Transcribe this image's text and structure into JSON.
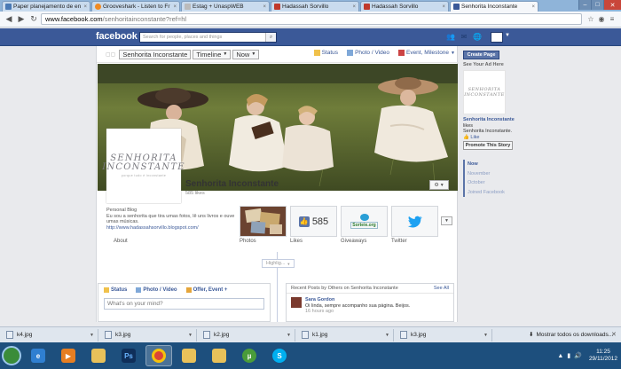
{
  "browser": {
    "tabs": [
      {
        "label": "Paper planejamento de en",
        "icon_color": "#4a7ab5",
        "active": false
      },
      {
        "label": "Grooveshark - Listen to Fr",
        "icon_color": "#f08a24",
        "active": false
      },
      {
        "label": "Estag + UnaspWEB",
        "icon_color": "#8a8a8a",
        "active": false
      },
      {
        "label": "Hadassah Sorvillo",
        "icon_color": "#c0392b",
        "active": false
      },
      {
        "label": "Hadassah Sorvillo",
        "icon_color": "#c0392b",
        "active": false
      },
      {
        "label": "Senhorita Inconstante",
        "icon_color": "#3b5998",
        "active": true
      }
    ],
    "url_host": "www.facebook.com",
    "url_path": "/senhoritainconstante?ref=hl"
  },
  "fb": {
    "logo": "facebook",
    "search_placeholder": "Search for people, places and things"
  },
  "timeline_bar": {
    "page_name": "Senhorita Inconstante",
    "timeline": "Timeline",
    "now": "Now",
    "status": "Status",
    "photo_video": "Photo / Video",
    "event_milestone": "Event, Milestone"
  },
  "profile": {
    "pic_line1": "SENHORITA",
    "pic_line2": "INCONSTANTE",
    "pic_line3": "porque tudo é inconstante",
    "name": "Senhorita Inconstante",
    "likes": "585 likes",
    "category": "Personal Blog",
    "description": "Eu sou a senhorita que tira umas fotos, lê uns livros e ouve umas músicas.",
    "url": "http://www.hadassahsorvillo.blogspot.com/",
    "about": "About"
  },
  "apps": [
    {
      "label": "Photos"
    },
    {
      "label": "Likes",
      "count": "585"
    },
    {
      "label": "Giveaways",
      "badge": "Sorteie.org"
    },
    {
      "label": "Twitter"
    }
  ],
  "highlights": "Highlig...",
  "composer": {
    "tab_status": "Status",
    "tab_photo": "Photo / Video",
    "tab_offer": "Offer, Event +",
    "placeholder": "What's on your mind?"
  },
  "recent": {
    "title": "Recent Posts by Others on Senhorita Inconstante",
    "see_all": "See All",
    "author": "Sara Gordon",
    "text": "Oi linda, sempre acompanho sua página. Beijos.",
    "time": "16 hours ago"
  },
  "right_col": {
    "create_page": "Create Page",
    "see_ad": "See Your Ad Here",
    "ad_name": "Senhorita Inconstante",
    "ad_likes_suffix": "likes",
    "ad_likes_line": "Senhorita Inconstante.",
    "ad_like": "Like",
    "promote": "Promote This Story",
    "scrubber": [
      "Now",
      "November",
      "October",
      "Joined Facebook"
    ]
  },
  "downloads": [
    {
      "name": "k4.jpg"
    },
    {
      "name": "k3.jpg"
    },
    {
      "name": "k2.jpg"
    },
    {
      "name": "k1.jpg"
    },
    {
      "name": "k3.jpg"
    }
  ],
  "downloads_show_all": "Mostrar todos os downloads...",
  "taskbar": {
    "time": "11:25",
    "date": "29/11/2012"
  }
}
